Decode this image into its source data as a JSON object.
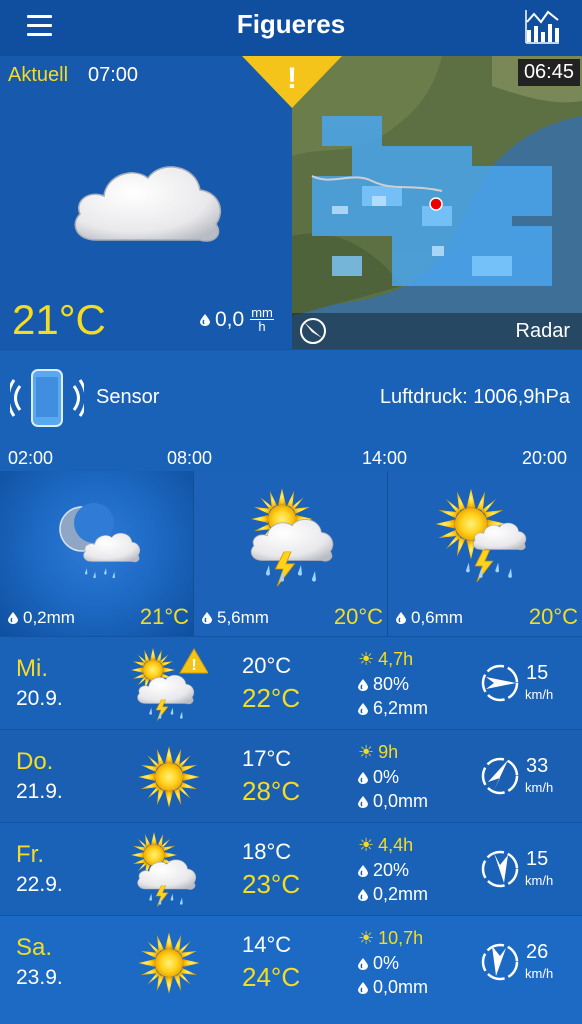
{
  "header": {
    "title": "Figueres",
    "menu_icon": "hamburger-icon",
    "chart_icon": "chart-icon"
  },
  "current": {
    "label": "Aktuell",
    "time": "07:00",
    "temp": "21°C",
    "precip_value": "0,0",
    "precip_unit_top": "mm",
    "precip_unit_bottom": "h",
    "icon": "cloud-icon"
  },
  "radar": {
    "time": "06:45",
    "label": "Radar"
  },
  "warning": {
    "icon": "warning-icon",
    "symbol": "!"
  },
  "sensor": {
    "label": "Sensor",
    "pressure": "Luftdruck: 1006,9hPa"
  },
  "hourly": {
    "times": [
      "02:00",
      "08:00",
      "14:00",
      "20:00"
    ],
    "columns": [
      {
        "precip": "0,2mm",
        "temp": "21°C",
        "icon": "night-cloud-rain-icon"
      },
      {
        "precip": "5,6mm",
        "temp": "20°C",
        "icon": "sun-thunderstorm-icon"
      },
      {
        "precip": "0,6mm",
        "temp": "20°C",
        "icon": "sun-thunderstorm-icon"
      }
    ]
  },
  "days": [
    {
      "name": "Mi.",
      "date": "20.9.",
      "min": "20°C",
      "max": "22°C",
      "sun": "4,7h",
      "prob": "80%",
      "amount": "6,2mm",
      "wind": "15",
      "wind_unit": "km/h",
      "wind_dir_deg": 280,
      "icon": "sun-thunderstorm-warning-icon"
    },
    {
      "name": "Do.",
      "date": "21.9.",
      "min": "17°C",
      "max": "28°C",
      "sun": "9h",
      "prob": "0%",
      "amount": "0,0mm",
      "wind": "33",
      "wind_unit": "km/h",
      "wind_dir_deg": 210,
      "icon": "sun-icon"
    },
    {
      "name": "Fr.",
      "date": "22.9.",
      "min": "18°C",
      "max": "23°C",
      "sun": "4,4h",
      "prob": "20%",
      "amount": "0,2mm",
      "wind": "15",
      "wind_unit": "km/h",
      "wind_dir_deg": 170,
      "icon": "sun-thunderstorm-icon"
    },
    {
      "name": "Sa.",
      "date": "23.9.",
      "min": "14°C",
      "max": "24°C",
      "sun": "10,7h",
      "prob": "0%",
      "amount": "0,0mm",
      "wind": "26",
      "wind_unit": "km/h",
      "wind_dir_deg": 160,
      "icon": "sun-icon"
    }
  ],
  "colors": {
    "accent": "#f5dc23",
    "background": "#1a62b8",
    "header": "#104f9f"
  }
}
